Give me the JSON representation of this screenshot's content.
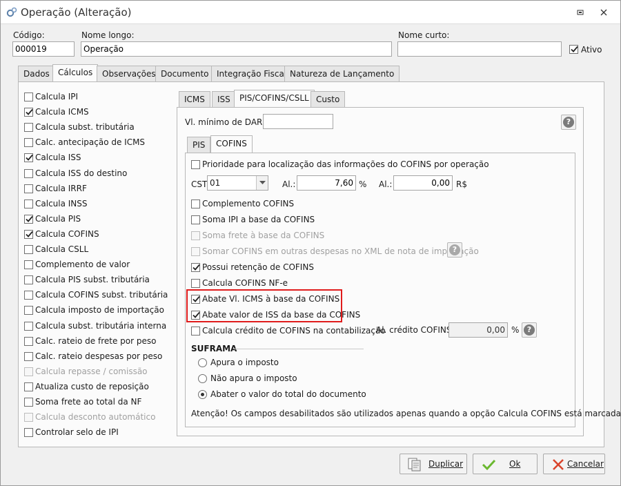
{
  "window": {
    "title": "Operação (Alteração)"
  },
  "header": {
    "codigo_label": "Código:",
    "codigo_value": "000019",
    "nome_longo_label": "Nome longo:",
    "nome_longo_value": "Operação",
    "nome_curto_label": "Nome curto:",
    "nome_curto_value": "",
    "ativo_label": "Ativo",
    "ativo_checked": true
  },
  "main_tabs": [
    "Dados",
    "Cálculos",
    "Observações",
    "Documento",
    "Integração Fiscal",
    "Natureza de Lançamento"
  ],
  "main_active_tab": "Cálculos",
  "left_checks": [
    {
      "label": "Calcula IPI",
      "checked": false,
      "disabled": false
    },
    {
      "label": "Calcula ICMS",
      "checked": true,
      "disabled": false
    },
    {
      "label": "Calcula subst. tributária",
      "checked": false,
      "disabled": false
    },
    {
      "label": "Calc. antecipação de ICMS",
      "checked": false,
      "disabled": false
    },
    {
      "label": "Calcula ISS",
      "checked": true,
      "disabled": false
    },
    {
      "label": "Calcula ISS do destino",
      "checked": false,
      "disabled": false
    },
    {
      "label": "Calcula IRRF",
      "checked": false,
      "disabled": false
    },
    {
      "label": "Calcula INSS",
      "checked": false,
      "disabled": false
    },
    {
      "label": "Calcula PIS",
      "checked": true,
      "disabled": false
    },
    {
      "label": "Calcula COFINS",
      "checked": true,
      "disabled": false
    },
    {
      "label": "Calcula CSLL",
      "checked": false,
      "disabled": false
    },
    {
      "label": "Complemento de valor",
      "checked": false,
      "disabled": false
    },
    {
      "label": "Calcula PIS subst. tributária",
      "checked": false,
      "disabled": false
    },
    {
      "label": "Calcula COFINS subst. tributária",
      "checked": false,
      "disabled": false
    },
    {
      "label": "Calcula imposto de importação",
      "checked": false,
      "disabled": false
    },
    {
      "label": "Calcula subst. tributária interna",
      "checked": false,
      "disabled": false
    },
    {
      "label": "Calc. rateio de frete por peso",
      "checked": false,
      "disabled": false
    },
    {
      "label": "Calc. rateio despesas por peso",
      "checked": false,
      "disabled": false
    },
    {
      "label": "Calcula repasse / comissão",
      "checked": false,
      "disabled": true
    },
    {
      "label": "Atualiza custo de reposição",
      "checked": false,
      "disabled": false
    },
    {
      "label": "Soma frete ao total da NF",
      "checked": false,
      "disabled": false
    },
    {
      "label": "Calcula desconto automático",
      "checked": false,
      "disabled": true
    },
    {
      "label": "Controlar selo de IPI",
      "checked": false,
      "disabled": false
    }
  ],
  "tax_tabs": [
    "ICMS",
    "ISS",
    "PIS/COFINS/CSLL",
    "Custo"
  ],
  "tax_active_tab": "PIS/COFINS/CSLL",
  "darf": {
    "label": "Vl. mínimo de DARF:",
    "value": ""
  },
  "sub_tabs": [
    "PIS",
    "COFINS"
  ],
  "sub_active_tab": "COFINS",
  "cofins": {
    "prioridade_label": "Prioridade para localização das informações do COFINS por operação",
    "cst_label": "CST:",
    "cst_value": "01",
    "al_label": "Al.:",
    "al_value": "7,60",
    "al_unit": "%",
    "al2_label": "Al.:",
    "al2_value": "0,00",
    "al2_unit": "R$",
    "options": [
      {
        "label": "Complemento COFINS",
        "checked": false,
        "disabled": false
      },
      {
        "label": "Soma IPI a base da COFINS",
        "checked": false,
        "disabled": false
      },
      {
        "label": "Soma frete à base da COFINS",
        "checked": false,
        "disabled": true
      },
      {
        "label": "Somar COFINS em outras despesas no XML de nota de importação",
        "checked": false,
        "disabled": true
      },
      {
        "label": "Possui retenção de COFINS",
        "checked": true,
        "disabled": false
      },
      {
        "label": "Calcula COFINS NF-e",
        "checked": false,
        "disabled": false
      },
      {
        "label": "Abate Vl. ICMS à base da COFINS",
        "checked": true,
        "disabled": false
      },
      {
        "label": "Abate valor de ISS da base da COFINS",
        "checked": true,
        "disabled": false
      },
      {
        "label": "Calcula crédito de COFINS na contabilização",
        "checked": false,
        "disabled": false
      }
    ],
    "credito_label": "Al. crédito COFINS:",
    "credito_value": "0,00",
    "credito_unit": "%",
    "suframa_title": "SUFRAMA",
    "suframa_options": [
      "Apura o imposto",
      "Não apura o imposto",
      "Abater o valor do total do documento"
    ],
    "suframa_selected": 2,
    "note": "Atenção! Os campos desabilitados são utilizados apenas quando a opção Calcula COFINS está marcada."
  },
  "buttons": {
    "duplicar": "Duplicar",
    "ok": "Ok",
    "cancelar": "Cancelar"
  },
  "help_glyph": "?",
  "colors": {
    "highlight": "#e01b1b",
    "ok_icon": "#6ab82f",
    "cancel_icon": "#d9442c"
  }
}
